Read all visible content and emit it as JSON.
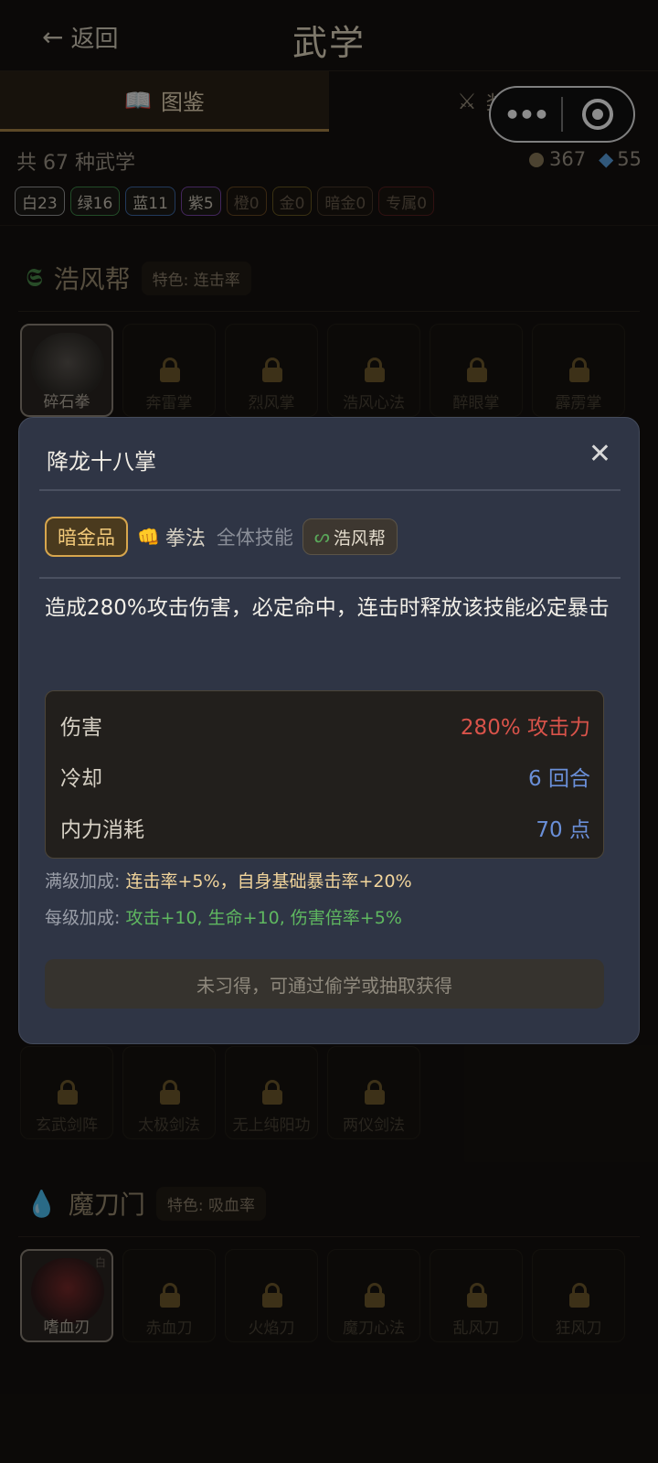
{
  "header": {
    "back_label": "返回",
    "title": "武学"
  },
  "tabs": [
    {
      "label": "图鉴",
      "icon": "book-icon"
    },
    {
      "label": "装配",
      "icon": "crossed-swords-icon"
    }
  ],
  "capsule": {
    "more": "•••",
    "close": "target-icon"
  },
  "summary": {
    "text": "共 67 种武学",
    "coins": "367",
    "gems": "55"
  },
  "rarity_chips": [
    {
      "label": "白23",
      "color": "#9a9a9a"
    },
    {
      "label": "绿16",
      "color": "#3e8a4a"
    },
    {
      "label": "蓝11",
      "color": "#3f6aa8"
    },
    {
      "label": "紫5",
      "color": "#7b45a8"
    },
    {
      "label": "橙0",
      "color": "#6b4a22"
    },
    {
      "label": "金0",
      "color": "#6a5a22"
    },
    {
      "label": "暗金0",
      "color": "#4a3a2a"
    },
    {
      "label": "专属0",
      "color": "#5a2020"
    }
  ],
  "sects": [
    {
      "name": "浩风帮",
      "tag": "特色: 连击率",
      "skills": [
        "碎石拳",
        "奔雷掌",
        "烈风掌",
        "浩风心法",
        "醉眼掌",
        "霹雳掌"
      ]
    },
    {
      "name": "",
      "tag": "",
      "skills": [
        "玄武剑阵",
        "太极剑法",
        "无上纯阳功",
        "两仪剑法"
      ]
    },
    {
      "name": "魔刀门",
      "tag": "特色: 吸血率",
      "skills": [
        "嗜血刃",
        "赤血刀",
        "火焰刀",
        "魔刀心法",
        "乱风刀",
        "狂风刀"
      ],
      "owned_grade": "白"
    }
  ],
  "modal": {
    "title": "降龙十八掌",
    "close": "✕",
    "grade": "暗金品",
    "type": "拳法",
    "scope": "全体技能",
    "sect": "浩风帮",
    "description": "造成280%攻击伤害，必定命中，连击时释放该技能必定暴击",
    "stats": [
      {
        "label": "伤害",
        "value": "280% 攻击力",
        "color": "#d9534a"
      },
      {
        "label": "冷却",
        "value": "6 回合",
        "color": "#6a8fd8"
      },
      {
        "label": "内力消耗",
        "value": "70 点",
        "color": "#6a8fd8"
      }
    ],
    "full_bonus_label": "满级加成:",
    "full_bonus_value": "连击率+5%，自身基础暴击率+20%",
    "level_bonus_label": "每级加成:",
    "level_bonus_value": "攻击+10, 生命+10, 伤害倍率+5%",
    "action": "未习得，可通过偷学或抽取获得"
  }
}
